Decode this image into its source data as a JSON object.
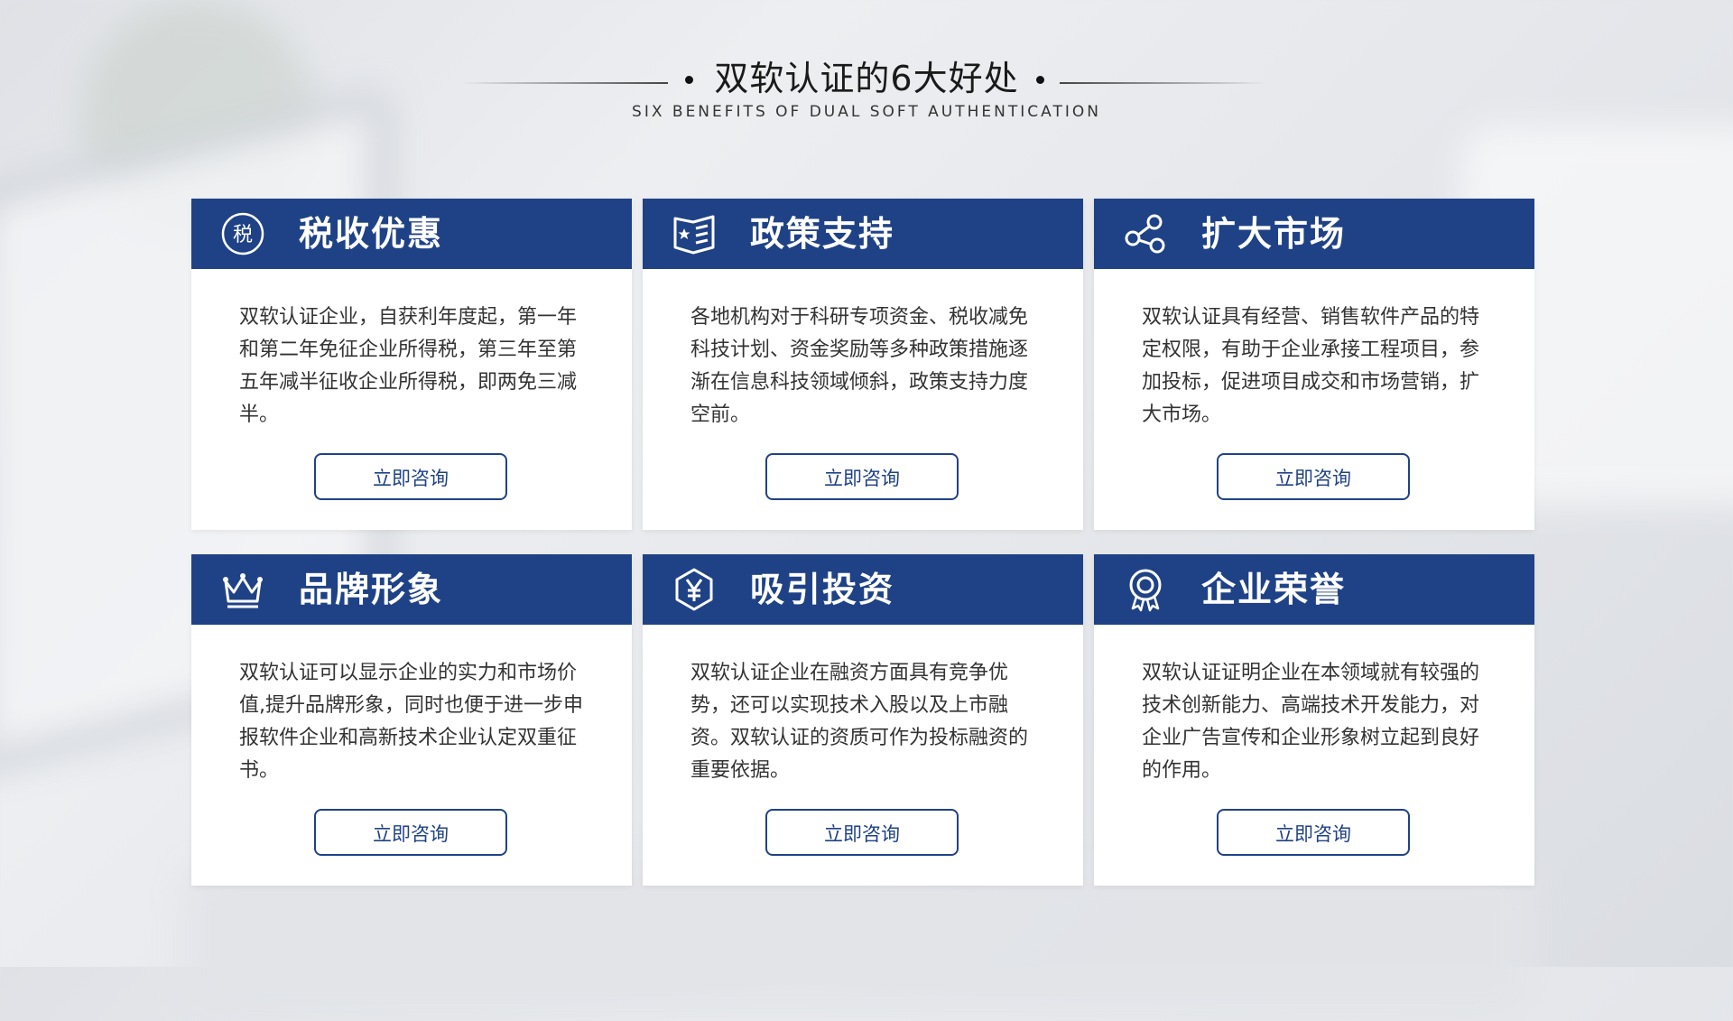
{
  "header": {
    "title": "双软认证的6大好处",
    "subtitle": "SIX BENEFITS OF DUAL SOFT AUTHENTICATION"
  },
  "colors": {
    "accent": "#1f4286",
    "card_bg": "#ffffff",
    "text": "#333333"
  },
  "cards": [
    {
      "icon": "tax-circle-icon",
      "icon_text": "税",
      "title": "税收优惠",
      "body": "双软认证企业，自获利年度起，第一年和第二年免征企业所得税，第三年至第五年减半征收企业所得税，即两免三减半。",
      "button": "立即咨询"
    },
    {
      "icon": "policy-document-icon",
      "title": "政策支持",
      "body": "各地机构对于科研专项资金、税收减免科技计划、资金奖励等多种政策措施逐渐在信息科技领域倾斜，政策支持力度空前。",
      "button": "立即咨询"
    },
    {
      "icon": "share-nodes-icon",
      "title": "扩大市场",
      "body": "双软认证具有经营、销售软件产品的特定权限，有助于企业承接工程项目，参加投标，促进项目成交和市场营销，扩大市场。",
      "button": "立即咨询"
    },
    {
      "icon": "crown-icon",
      "title": "品牌形象",
      "body": "双软认证可以显示企业的实力和市场价值,提升品牌形象，同时也便于进一步申报软件企业和高新技术企业认定双重征书。",
      "button": "立即咨询"
    },
    {
      "icon": "yen-hexagon-icon",
      "title": "吸引投资",
      "body": "双软认证企业在融资方面具有竞争优势，还可以实现技术入股以及上市融资。双软认证的资质可作为投标融资的重要依据。",
      "button": "立即咨询"
    },
    {
      "icon": "award-medal-icon",
      "title": "企业荣誉",
      "body": "双软认证证明企业在本领域就有较强的技术创新能力、高端技术开发能力，对企业广告宣传和企业形象树立起到良好的作用。",
      "button": "立即咨询"
    }
  ]
}
